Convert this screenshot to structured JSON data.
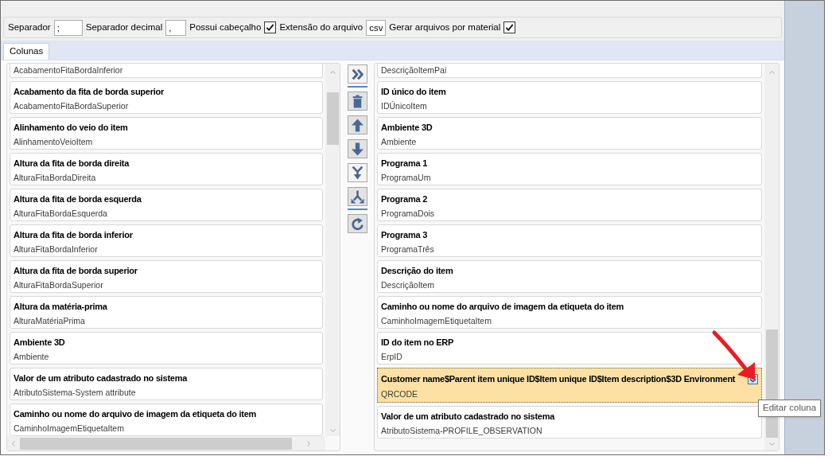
{
  "options": [
    {
      "kind": "text",
      "label": "Separador",
      "value": ";"
    },
    {
      "kind": "text",
      "label": "Separador decimal",
      "value": ","
    },
    {
      "kind": "checkbox",
      "label": "Possui cabeçalho",
      "checked": true
    },
    {
      "kind": "text",
      "label": "Extensão do arquivo",
      "value": "csv"
    },
    {
      "kind": "checkbox",
      "label": "Gerar arquivos por material",
      "checked": true
    }
  ],
  "tabs": [
    {
      "label": "Colunas",
      "selected": true
    }
  ],
  "available_columns": [
    {
      "subtitle": "AcabamentoFitaBordaInferior"
    },
    {
      "title": "Acabamento da fita de borda superior",
      "subtitle": "AcabamentoFitaBordaSuperior"
    },
    {
      "title": "Alinhamento do veio do item",
      "subtitle": "AlinhamentoVeioItem"
    },
    {
      "title": "Altura da fita de borda direita",
      "subtitle": "AlturaFitaBordaDireita"
    },
    {
      "title": "Altura da fita de borda esquerda",
      "subtitle": "AlturaFitaBordaEsquerda"
    },
    {
      "title": "Altura da fita de borda inferior",
      "subtitle": "AlturaFitaBordaInferior"
    },
    {
      "title": "Altura da fita de borda superior",
      "subtitle": "AlturaFitaBordaSuperior"
    },
    {
      "title": "Altura da matéria-prima",
      "subtitle": "AlturaMatériaPrima"
    },
    {
      "title": "Ambiente 3D",
      "subtitle": "Ambiente"
    },
    {
      "title": "Valor de um atributo cadastrado no sistema",
      "subtitle": "AtributoSistema-System attribute"
    },
    {
      "title": "Caminho ou nome do arquivo de imagem da etiqueta do item",
      "subtitle": "CaminhoImagemEtiquetaItem"
    }
  ],
  "selected_columns": [
    {
      "subtitle": "DescriçãoItemPai",
      "selected": false
    },
    {
      "title": "ID único do item",
      "subtitle": "IDÚnicoItem",
      "selected": false
    },
    {
      "title": "Ambiente 3D",
      "subtitle": "Ambiente",
      "selected": false
    },
    {
      "title": "Programa 1",
      "subtitle": "ProgramaUm",
      "selected": false
    },
    {
      "title": "Programa 2",
      "subtitle": "ProgramaDois",
      "selected": false
    },
    {
      "title": "Programa 3",
      "subtitle": "ProgramaTrês",
      "selected": false
    },
    {
      "title": "Descrição do item",
      "subtitle": "DescriçãoItem",
      "selected": false
    },
    {
      "title": "Caminho ou nome do arquivo de imagem da etiqueta do item",
      "subtitle": "CaminhoImagemEtiquetaItem",
      "selected": false
    },
    {
      "title": "ID do item no ERP",
      "subtitle": "ErpID",
      "selected": false
    },
    {
      "title": "Customer name$Parent item unique ID$Item unique ID$Item description$3D Environment",
      "subtitle": "QRCODE",
      "selected": true
    },
    {
      "title": "Valor de um atributo cadastrado no sistema",
      "subtitle": "AtributoSistema-PROFILE_OBSERVATION",
      "selected": false
    }
  ],
  "tooltip": {
    "text": "Editar coluna"
  }
}
